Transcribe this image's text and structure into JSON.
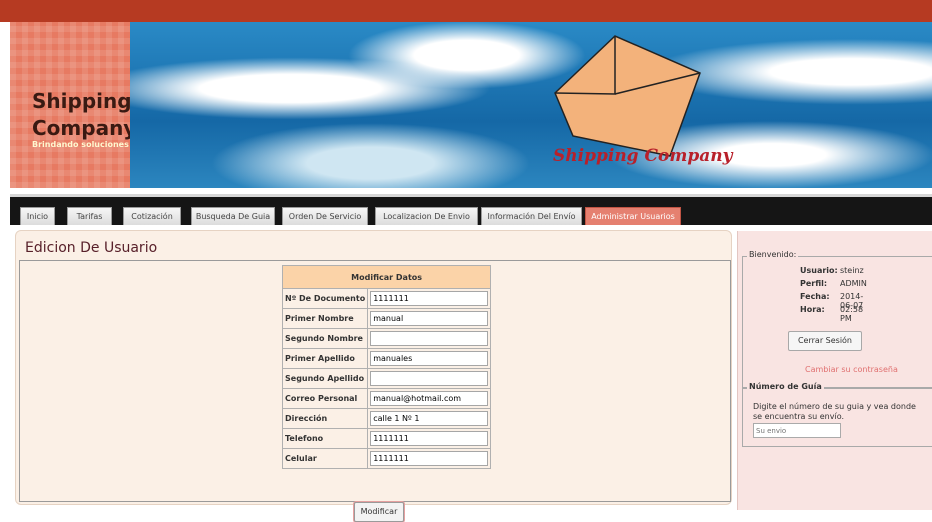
{
  "header": {
    "brand_title": "Shipping Company",
    "brand_subtitle": "Brindando soluciones",
    "banner_signature": "Shipping Company",
    "colors": {
      "top_bar": "#b63a22",
      "brand_bg": "#e77a62",
      "nav_bg": "#151515",
      "active_tab": "#e58070"
    }
  },
  "nav": {
    "tabs": [
      {
        "label": "Inicio"
      },
      {
        "label": "Tarifas"
      },
      {
        "label": "Cotización"
      },
      {
        "label": "Busqueda De Guia"
      },
      {
        "label": "Orden De Servicio"
      },
      {
        "label": "Localizacion De Envio"
      },
      {
        "label": "Información Del Envío"
      },
      {
        "label": "Administrar Usuarios"
      }
    ],
    "active": "Administrar Usuarios"
  },
  "main": {
    "title": "Edicion De Usuario",
    "form": {
      "header": "Modificar Datos",
      "fields": [
        {
          "label": "Nº De Documento",
          "value": "1111111"
        },
        {
          "label": "Primer Nombre",
          "value": "manual"
        },
        {
          "label": "Segundo Nombre",
          "value": ""
        },
        {
          "label": "Primer Apellido",
          "value": "manuales"
        },
        {
          "label": "Segundo Apellido",
          "value": ""
        },
        {
          "label": "Correo Personal",
          "value": "manual@hotmail.com"
        },
        {
          "label": "Dirección",
          "value": "calle 1 Nº 1"
        },
        {
          "label": "Telefono",
          "value": "1111111"
        },
        {
          "label": "Celular",
          "value": "1111111"
        }
      ],
      "submit_label": "Modificar"
    }
  },
  "sidebar": {
    "welcome": {
      "legend": "Bienvenido:",
      "user_label": "Usuario:",
      "user_value": "steinz",
      "profile_label": "Perfil:",
      "profile_value": "ADMIN",
      "date_label": "Fecha:",
      "date_value": "2014-06-07",
      "time_label": "Hora:",
      "time_value": "02:58 PM",
      "logout_label": "Cerrar Sesión",
      "change_password_label": "Cambiar su contraseña"
    },
    "guide": {
      "legend": "Número de Guía",
      "text": "Digite el número de su guia y vea donde se encuentra su envío.",
      "placeholder": "Su envio"
    }
  }
}
